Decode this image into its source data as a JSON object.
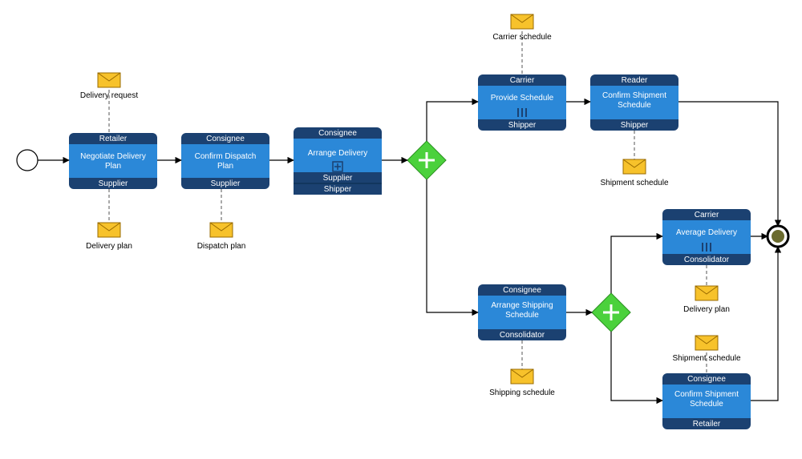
{
  "tasks": {
    "t1": {
      "role": "Retailer",
      "title1": "Negotiate Delivery",
      "title2": "Plan",
      "footers": [
        "Supplier"
      ],
      "marker": ""
    },
    "t2": {
      "role": "Consignee",
      "title1": "Confirm Dispatch",
      "title2": "Plan",
      "footers": [
        "Supplier"
      ],
      "marker": ""
    },
    "t3": {
      "role": "Consignee",
      "title1": "Arrange Delivery",
      "title2": "",
      "footers": [
        "Supplier",
        "Shipper"
      ],
      "marker": "sub"
    },
    "t4": {
      "role": "Carrier",
      "title1": "Provide Schedule",
      "title2": "",
      "footers": [
        "Shipper"
      ],
      "marker": "multi"
    },
    "t5": {
      "role": "Reader",
      "title1": "Confirm Shipment",
      "title2": "Schedule",
      "footers": [
        "Shipper"
      ],
      "marker": ""
    },
    "t6": {
      "role": "Consignee",
      "title1": "Arrange Shipping",
      "title2": "Schedule",
      "footers": [
        "Consolidator"
      ],
      "marker": ""
    },
    "t7": {
      "role": "Carrier",
      "title1": "Average Delivery",
      "title2": "",
      "footers": [
        "Consolidator"
      ],
      "marker": "multi"
    },
    "t8": {
      "role": "Consignee",
      "title1": "Confirm Shipment",
      "title2": "Schedule",
      "footers": [
        "Retailer"
      ],
      "marker": ""
    }
  },
  "msgs": {
    "m1": "Delivery request",
    "m2": "Delivery plan",
    "m3": "Dispatch plan",
    "m4": "Carrier schedule",
    "m5": "Shipment schedule",
    "m6": "Shipping schedule",
    "m7": "Delivery plan",
    "m8": "Shipment schedule"
  }
}
